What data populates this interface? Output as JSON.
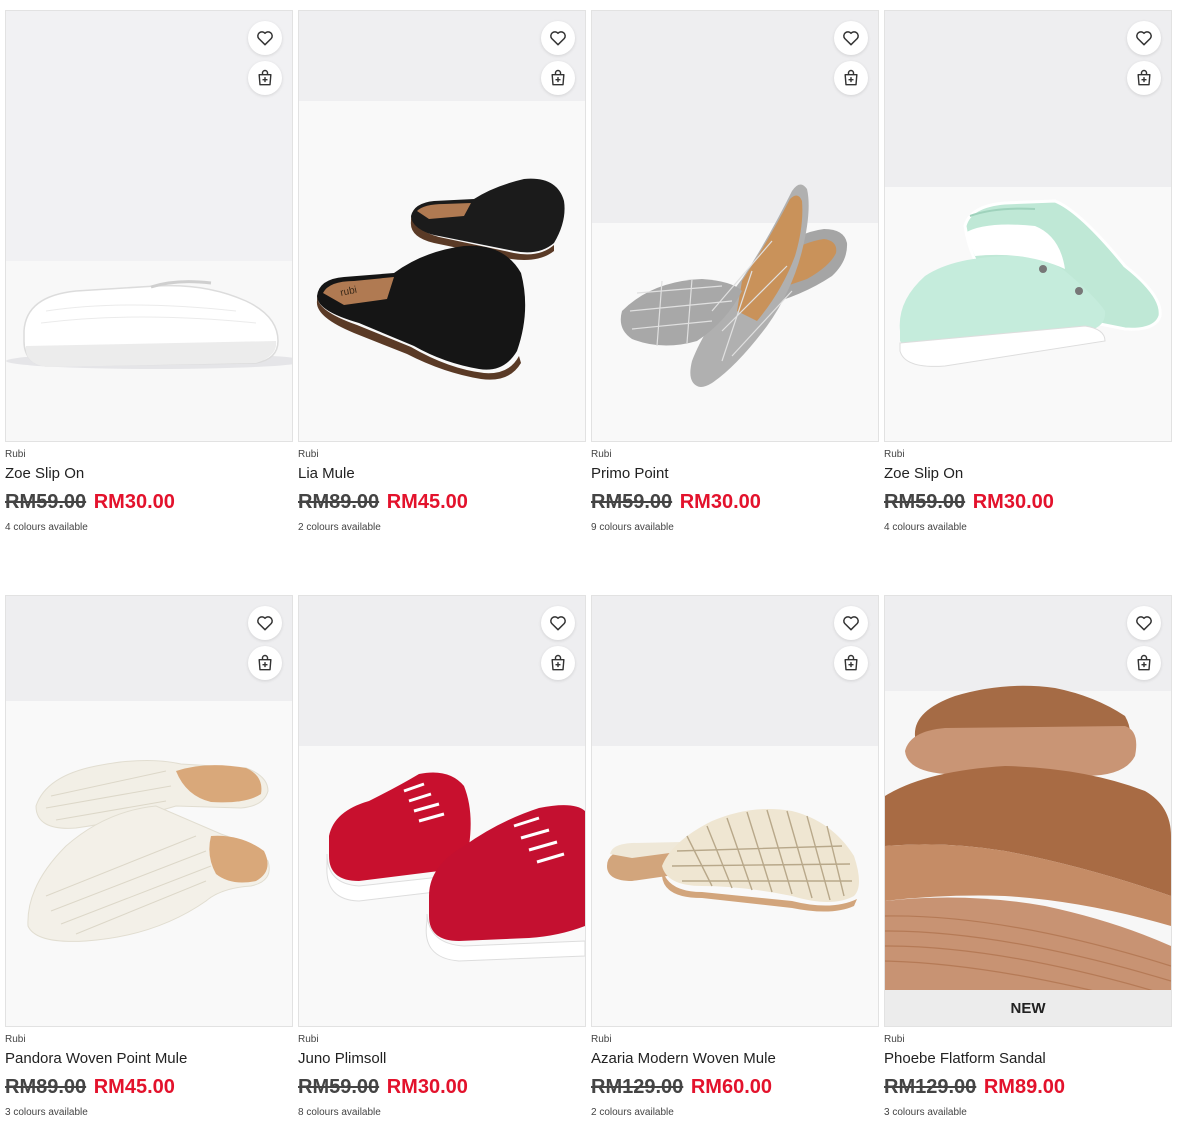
{
  "products": [
    {
      "brand": "Rubi",
      "name": "Zoe Slip On",
      "original_price": "RM59.00",
      "sale_price": "RM30.00",
      "colours": "4 colours available",
      "image": "white-slip-on-shoe",
      "badge": ""
    },
    {
      "brand": "Rubi",
      "name": "Lia Mule",
      "original_price": "RM89.00",
      "sale_price": "RM45.00",
      "colours": "2 colours available",
      "image": "black-mule-pair",
      "badge": ""
    },
    {
      "brand": "Rubi",
      "name": "Primo Point",
      "original_price": "RM59.00",
      "sale_price": "RM30.00",
      "colours": "9 colours available",
      "image": "grey-check-pointed-flats",
      "badge": ""
    },
    {
      "brand": "Rubi",
      "name": "Zoe Slip On",
      "original_price": "RM59.00",
      "sale_price": "RM30.00",
      "colours": "4 colours available",
      "image": "mint-slip-on-pair",
      "badge": ""
    },
    {
      "brand": "Rubi",
      "name": "Pandora Woven Point Mule",
      "original_price": "RM89.00",
      "sale_price": "RM45.00",
      "colours": "3 colours available",
      "image": "white-woven-mule-pair",
      "badge": ""
    },
    {
      "brand": "Rubi",
      "name": "Juno Plimsoll",
      "original_price": "RM59.00",
      "sale_price": "RM30.00",
      "colours": "8 colours available",
      "image": "red-lace-up-plimsoll-pair",
      "badge": ""
    },
    {
      "brand": "Rubi",
      "name": "Azaria Modern Woven Mule",
      "original_price": "RM129.00",
      "sale_price": "RM60.00",
      "colours": "2 colours available",
      "image": "cream-caged-woven-mule",
      "badge": ""
    },
    {
      "brand": "Rubi",
      "name": "Phoebe Flatform Sandal",
      "original_price": "RM129.00",
      "sale_price": "RM89.00",
      "colours": "3 colours available",
      "image": "tan-flatform-sandal",
      "badge": "NEW"
    }
  ],
  "icons": {
    "wishlist": "heart-outline-icon",
    "add_to_bag": "shopping-bag-plus-icon"
  },
  "colors": {
    "sale_price": "#e3122c",
    "original_price": "#444444",
    "badge_bg": "#ececec"
  }
}
